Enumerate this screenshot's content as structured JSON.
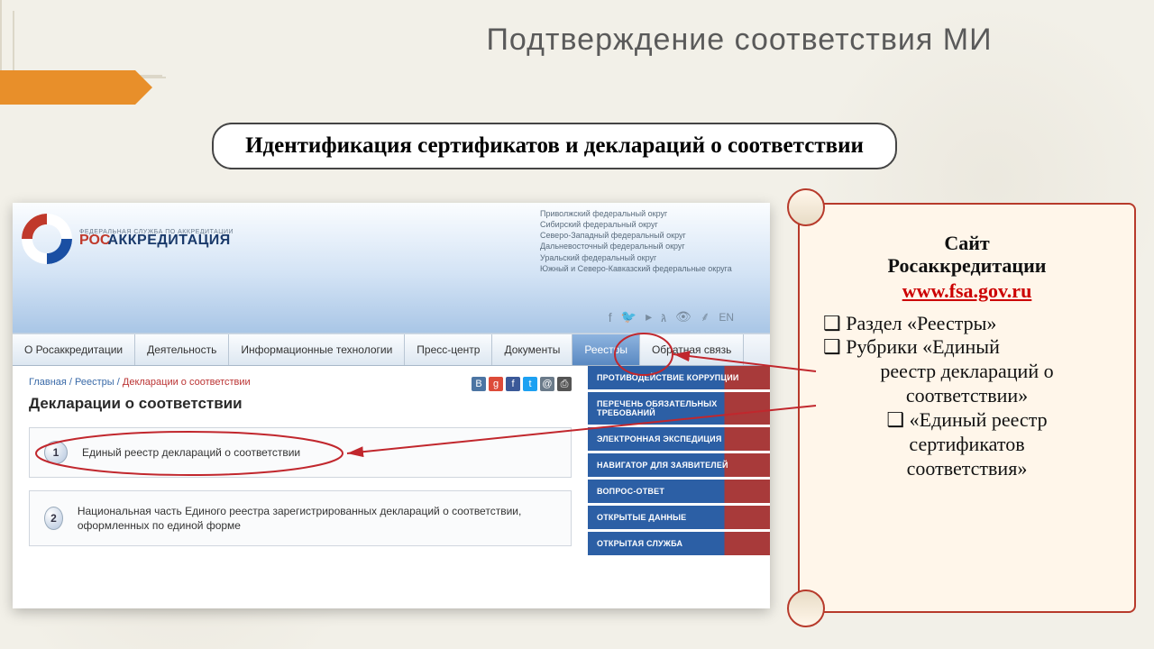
{
  "slide": {
    "title": "Подтверждение соответствия МИ",
    "subtitle": "Идентификация  сертификатов и деклараций о соответствии"
  },
  "logo": {
    "tag": "ФЕДЕРАЛЬНАЯ СЛУЖБА ПО АККРЕДИТАЦИИ",
    "pre": "РОС",
    "name": "АККРЕДИТАЦИЯ"
  },
  "districts": [
    "Приволжский федеральный округ",
    "Сибирский федеральный округ",
    "Северо-Западный федеральный округ",
    "Дальневосточный федеральный округ",
    "Уральский федеральный округ",
    "Южный и Северо-Кавказский федеральные округа"
  ],
  "header_icons": {
    "lang": "EN"
  },
  "nav": {
    "items": [
      "О Росаккредитации",
      "Деятельность",
      "Информационные технологии",
      "Пресс-центр",
      "Документы",
      "Реестры",
      "Обратная связь"
    ],
    "active_index": 5
  },
  "breadcrumbs": {
    "a": "Главная",
    "b": "Реестры",
    "c": "Декларации о соответствии"
  },
  "page_title": "Декларации о соответствии",
  "entries": [
    {
      "n": "1",
      "text": "Единый реестр деклараций о соответствии"
    },
    {
      "n": "2",
      "text": "Национальная часть Единого реестра зарегистрированных деклараций о соответствии, оформленных по единой форме"
    }
  ],
  "side_links": [
    "ПРОТИВОДЕЙСТВИЕ КОРРУПЦИИ",
    "ПЕРЕЧЕНЬ ОБЯЗАТЕЛЬНЫХ ТРЕБОВАНИЙ",
    "ЭЛЕКТРОННАЯ ЭКСПЕДИЦИЯ",
    "НАВИГАТОР ДЛЯ ЗАЯВИТЕЛЕЙ",
    "ВОПРОС-ОТВЕТ",
    "ОТКРЫТЫЕ ДАННЫЕ",
    "ОТКРЫТАЯ СЛУЖБА"
  ],
  "note": {
    "heading_l1": "Сайт",
    "heading_l2": "Росаккредитации",
    "url": "www.fsa.gov.ru",
    "b1": "Раздел «Реестры»",
    "b2a": "Рубрики «Единый",
    "b2b": "реестр деклараций о",
    "b2c": "соответствии»",
    "b3a": "«Единый реестр",
    "b3b": "сертификатов",
    "b3c": "соответствия»"
  }
}
